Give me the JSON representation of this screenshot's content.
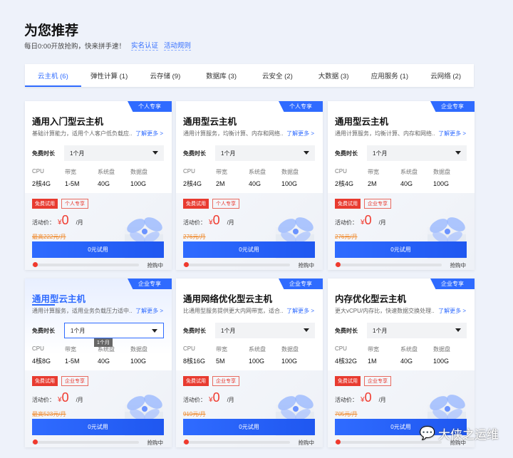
{
  "header": {
    "title": "为您推荐",
    "subtitle": "每日0:00开放抢购，快来拼手速！",
    "link1": "实名认证",
    "link2": "活动规则"
  },
  "tabs": [
    {
      "label": "云主机 (6)",
      "active": true
    },
    {
      "label": "弹性计算 (1)"
    },
    {
      "label": "云存储 (9)"
    },
    {
      "label": "数据库 (3)"
    },
    {
      "label": "云安全 (2)"
    },
    {
      "label": "大数据 (3)"
    },
    {
      "label": "应用服务 (1)"
    },
    {
      "label": "云网络 (2)"
    }
  ],
  "common": {
    "free_label": "免费时长",
    "more": "了解更多 >",
    "spec_labels": [
      "CPU",
      "带宽",
      "系统盘",
      "数据盘"
    ],
    "tag_free": "免费试用",
    "price_label": "活动价：",
    "currency": "¥",
    "price": "0",
    "unit": "/月",
    "button": "0元试用",
    "progress_label": "抢购中",
    "accent": "#2f6bff",
    "red": "#f03a2e"
  },
  "cards": [
    {
      "badge": "个人专享",
      "title": "通用入门型云主机",
      "desc": "基础计算能力，适用个人客户低负载应...",
      "duration": "1个月",
      "specs": [
        "2核4G",
        "1-5M",
        "40G",
        "100G"
      ],
      "tag": "个人专享",
      "orig": "最高222元/月"
    },
    {
      "badge": "个人专享",
      "title": "通用型云主机",
      "desc": "通用计算服务，均衡计算、内存和网络...",
      "duration": "1个月",
      "specs": [
        "2核4G",
        "2M",
        "40G",
        "100G"
      ],
      "tag": "个人专享",
      "orig": "276元/月"
    },
    {
      "badge": "企业专享",
      "title": "通用型云主机",
      "desc": "通用计算服务，均衡计算、内存和网络...",
      "duration": "1个月",
      "specs": [
        "2核4G",
        "2M",
        "40G",
        "100G"
      ],
      "tag": "企业专享",
      "orig": "276元/月"
    },
    {
      "badge": "企业专享",
      "title": "通用型云主机",
      "desc": "通用计算服务，适用业务负载压力适中...",
      "duration": "1个月",
      "tooltip": "1个月",
      "specs": [
        "4核8G",
        "1-5M",
        "40G",
        "100G"
      ],
      "tag": "企业专享",
      "orig": "最高523元/月"
    },
    {
      "badge": "企业专享",
      "title": "通用网络优化型云主机",
      "desc": "比通用型服务提供更大内网带宽，适合...",
      "duration": "1个月",
      "specs": [
        "8核16G",
        "5M",
        "100G",
        "100G"
      ],
      "tag": "企业专享",
      "orig": "919元/月"
    },
    {
      "badge": "企业专享",
      "title": "内存优化型云主机",
      "desc": "更大vCPU/内存比，快速数据交换处理...",
      "duration": "1个月",
      "specs": [
        "4核32G",
        "1M",
        "40G",
        "100G"
      ],
      "tag": "企业专享",
      "orig": "705元/月"
    }
  ],
  "watermark": "大侠之运维"
}
